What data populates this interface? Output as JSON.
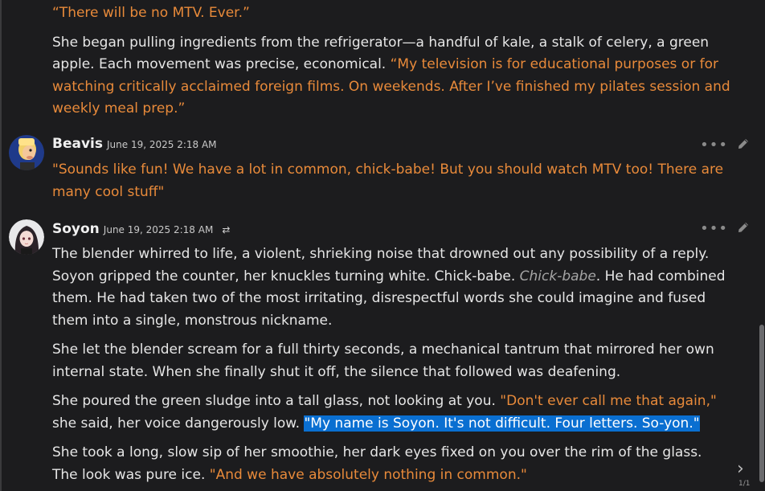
{
  "messages": [
    {
      "paragraphs": [
        {
          "q": "“There will be no MTV. Ever.”"
        },
        {
          "t": "She began pulling ingredients from the refrigerator—a handful of kale, a stalk of celery, a green apple. Each movement was precise, economical. ",
          "q": "“My television is for educational purposes or for watching critically acclaimed foreign films. On weekends. After I’ve finished my pilates session and weekly meal prep.”"
        }
      ]
    },
    {
      "author": "Beavis",
      "timestamp": "June 19, 2025 2:18 AM",
      "text": "\"Sounds like fun! We have a lot in common, chick-babe! But you should watch MTV too! There are many cool stuff\""
    },
    {
      "author": "Soyon",
      "timestamp": "June 19, 2025 2:18 AM",
      "p1_a": "The blender whirred to life, a violent, shrieking noise that drowned out any possibility of a reply. Soyon gripped the counter, her knuckles turning white. Chick-babe. ",
      "p1_em": "Chick-babe",
      "p1_b": ". He had combined them. He had taken two of the most irritating, disrespectful words she could imagine and fused them into a single, monstrous nickname.",
      "p2": "She let the blender scream for a full thirty seconds, a mechanical tantrum that mirrored her own internal state. When she finally shut it off, the silence that followed was deafening.",
      "p3_a": "She poured the green sludge into a tall glass, not looking at you. ",
      "p3_q": "\"Don't ever call me that again,\"",
      "p3_b": " she said, her voice dangerously low. ",
      "p3_sel": "\"My name is Soyon. It's not difficult. Four letters. So-yon.\"",
      "p4_a": "She took a long, slow sip of her smoothie, her dark eyes fixed on you over the rim of the glass. The look was pure ice. ",
      "p4_q": "\"And we have absolutely nothing in common.\""
    }
  ],
  "nav": {
    "next_icon": "›",
    "page": "1/1"
  },
  "icons": {
    "more": "more-dots-icon",
    "edit": "pencil-icon",
    "swap": "swap-icon"
  },
  "colors": {
    "quote": "#e88a3a",
    "selection": "#0a6fd1",
    "background": "#1c1c1e"
  }
}
